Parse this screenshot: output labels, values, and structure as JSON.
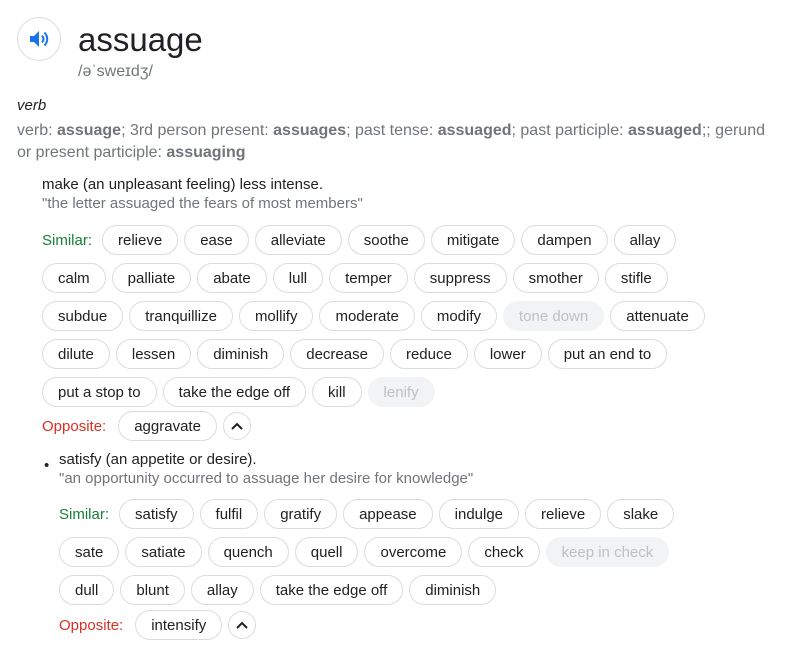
{
  "header": {
    "word": "assuage",
    "phonetic": "/əˈsweɪdʒ/",
    "audio_icon": "speaker-icon"
  },
  "entry": {
    "part_of_speech": "verb",
    "forms": [
      {
        "label": "verb: ",
        "value": "assuage"
      },
      {
        "label": "; 3rd person present: ",
        "value": "assuages"
      },
      {
        "label": "; past tense: ",
        "value": "assuaged"
      },
      {
        "label": "; past participle: ",
        "value": "assuaged"
      },
      {
        "label": "; gerund or present participle: ",
        "value": "assuaging"
      }
    ],
    "forms_trailing": ""
  },
  "sense1": {
    "definition": "make (an unpleasant feeling) less intense.",
    "example": "\"the letter assuaged the fears of most members\"",
    "similar_label": "Similar:",
    "similar_rows": [
      [
        "relieve",
        "ease",
        "alleviate",
        "soothe",
        "mitigate",
        "dampen",
        "allay"
      ],
      [
        "calm",
        "palliate",
        "abate",
        "lull",
        "temper",
        "suppress",
        "smother",
        "stifle"
      ],
      [
        "subdue",
        "tranquillize",
        "mollify",
        "moderate",
        "modify",
        "tone down",
        "attenuate"
      ],
      [
        "dilute",
        "lessen",
        "diminish",
        "decrease",
        "reduce",
        "lower",
        "put an end to"
      ],
      [
        "put a stop to",
        "take the edge off",
        "kill",
        "lenify"
      ]
    ],
    "disabled": [
      "tone down",
      "lenify"
    ],
    "opposite_label": "Opposite:",
    "opposites": [
      "aggravate"
    ]
  },
  "sense2": {
    "bullet": "•",
    "definition": "satisfy (an appetite or desire).",
    "example": "\"an opportunity occurred to assuage her desire for knowledge\"",
    "similar_label": "Similar:",
    "similar_rows": [
      [
        "satisfy",
        "fulfil",
        "gratify",
        "appease",
        "indulge",
        "relieve",
        "slake"
      ],
      [
        "sate",
        "satiate",
        "quench",
        "quell",
        "overcome",
        "check",
        "keep in check"
      ],
      [
        "dull",
        "blunt",
        "allay",
        "take the edge off",
        "diminish"
      ]
    ],
    "disabled": [
      "keep in check"
    ],
    "opposite_label": "Opposite:",
    "opposites": [
      "intensify"
    ]
  },
  "colors": {
    "similar": "#188038",
    "opposite": "#d93025",
    "audio_icon": "#1a73e8"
  }
}
